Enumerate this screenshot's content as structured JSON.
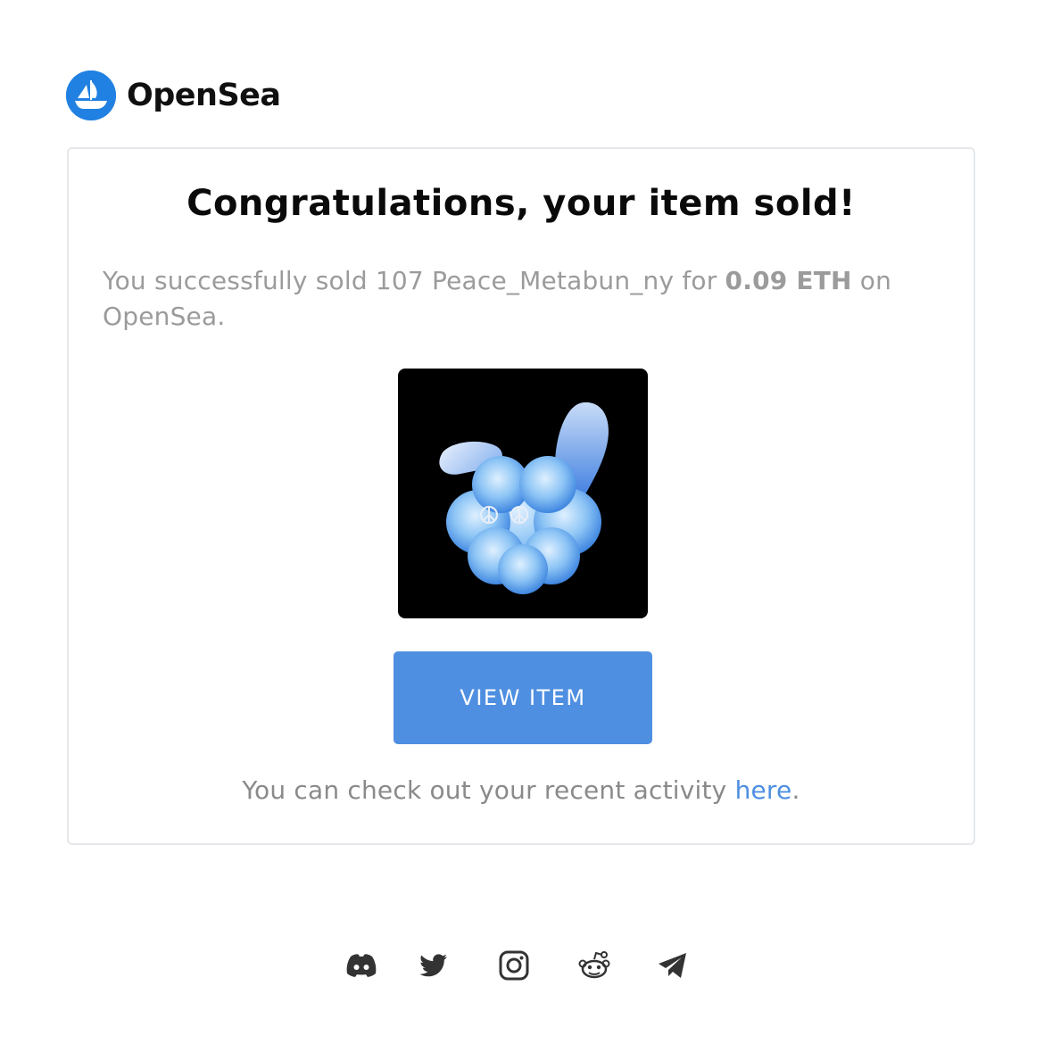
{
  "brand": {
    "name": "OpenSea",
    "accent_color": "#2081e2",
    "logo_icon": "opensea-ship-icon"
  },
  "card": {
    "headline": "Congratulations, your item sold!",
    "summary_prefix": "You successfully sold 107 Peace_Metabun_ny for ",
    "price": "0.09 ETH",
    "summary_suffix": " on OpenSea.",
    "image_icon": "metabun-cloud-bunny-image",
    "button_label": "VIEW ITEM",
    "button_color": "#4f8fe1",
    "activity_prefix": "You can check out your recent activity ",
    "activity_link": "here",
    "activity_suffix": "."
  },
  "social": [
    {
      "name": "discord-icon"
    },
    {
      "name": "twitter-icon"
    },
    {
      "name": "instagram-icon"
    },
    {
      "name": "reddit-icon"
    },
    {
      "name": "telegram-icon"
    }
  ]
}
